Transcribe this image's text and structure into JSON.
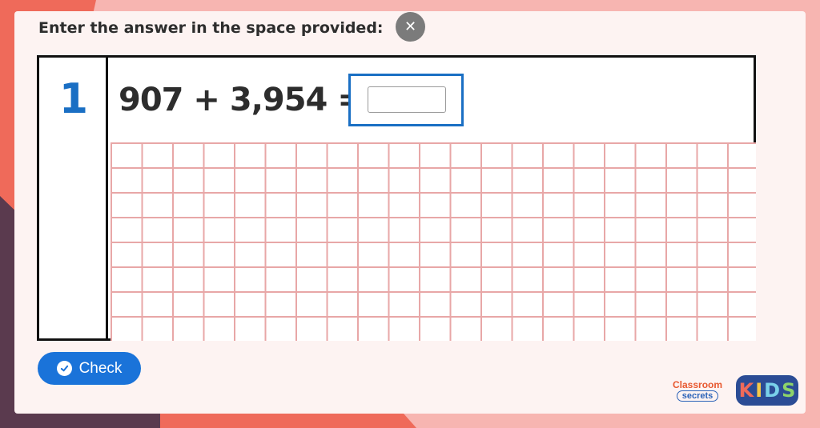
{
  "instruction": "Enter the answer in the space provided:",
  "close_icon": "close-icon",
  "question": {
    "number": "1",
    "equation": "907 + 3,954 =",
    "answer_value": "",
    "answer_placeholder": ""
  },
  "check_button": {
    "label": "Check",
    "icon": "check-circle-icon"
  },
  "logo": {
    "classroom_line1": "Classroom",
    "classroom_line2": "secrets",
    "kids": [
      "K",
      "I",
      "D",
      "S"
    ]
  },
  "colors": {
    "accent_blue": "#1a73d9",
    "number_blue": "#1a6fc4",
    "grid_pink": "#e8a7a7",
    "background_coral": "#ef6a5a",
    "background_pink": "#f7b5b1"
  }
}
